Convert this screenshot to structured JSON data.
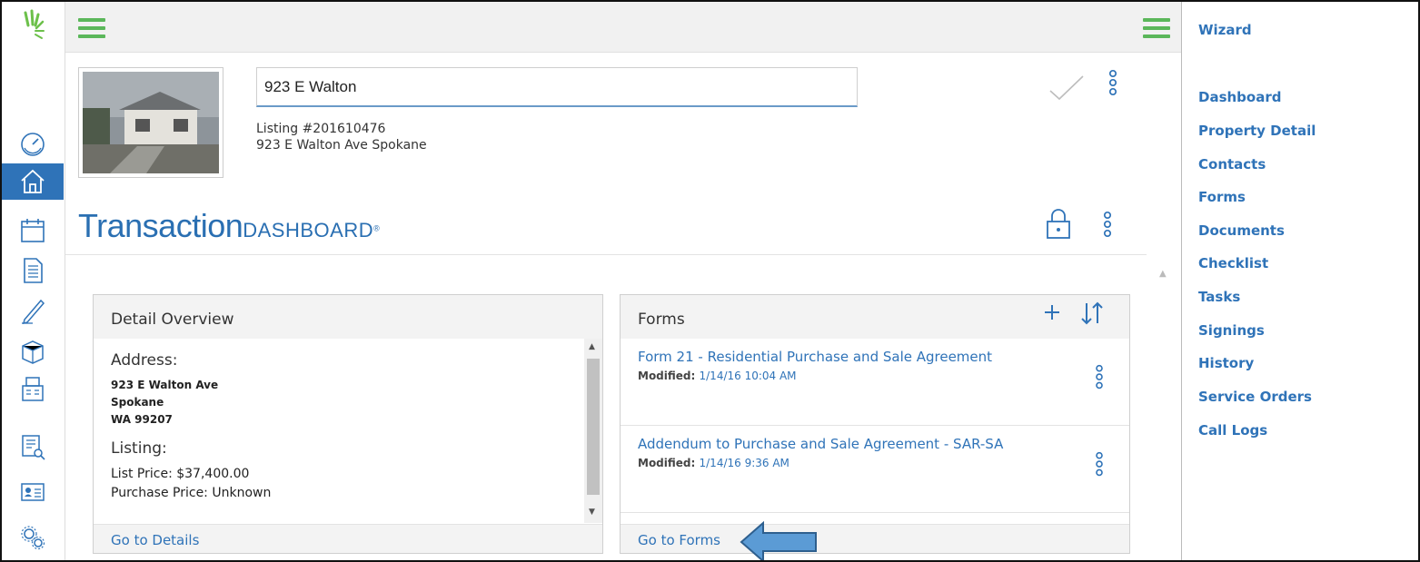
{
  "property": {
    "address_input_value": "923 E Walton",
    "listing_number": "Listing #201610476",
    "full_address": "923 E Walton Ave Spokane"
  },
  "brand": {
    "word_main": "Transaction",
    "word_sub": "DASHBOARD",
    "reg_mark": "®"
  },
  "detail_overview": {
    "title": "Detail Overview",
    "address_label": "Address:",
    "address_lines": [
      "923 E Walton Ave",
      "Spokane",
      "WA 99207"
    ],
    "listing_label": "Listing:",
    "list_price": "List Price: $37,400.00",
    "purchase_price": "Purchase Price: Unknown",
    "footer_link": "Go to Details"
  },
  "forms_card": {
    "title": "Forms",
    "items": [
      {
        "title": "Form 21 - Residential Purchase and Sale Agreement",
        "modified_label": "Modified:",
        "modified_value": "1/14/16 10:04 AM"
      },
      {
        "title": "Addendum to Purchase and Sale Agreement - SAR-SA",
        "modified_label": "Modified:",
        "modified_value": "1/14/16 9:36 AM"
      }
    ],
    "footer_link": "Go to Forms"
  },
  "right_panel": {
    "title": "Wizard",
    "links": [
      "Dashboard",
      "Property Detail",
      "Contacts",
      "Forms",
      "Documents",
      "Checklist",
      "Tasks",
      "Signings",
      "History",
      "Service Orders",
      "Call Logs"
    ]
  },
  "icons": {
    "rail": [
      "gauge-icon",
      "home-icon",
      "calendar-icon",
      "document-icon",
      "pen-icon",
      "box-icon",
      "fax-icon",
      "search-document-icon",
      "contact-card-icon",
      "gears-icon"
    ]
  },
  "colors": {
    "accent_blue": "#2f73b8",
    "menu_green": "#5bb75a",
    "logo_green": "#6cc04a"
  }
}
